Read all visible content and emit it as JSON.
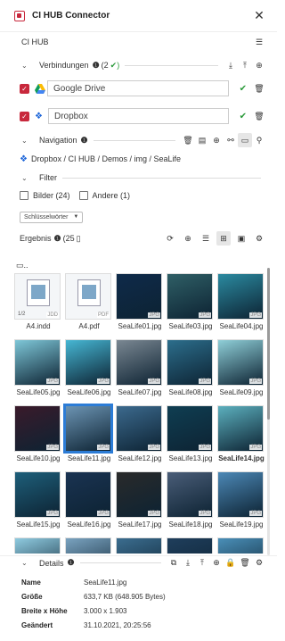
{
  "title": "CI HUB Connector",
  "close": "✕",
  "connector": {
    "label": "CI HUB"
  },
  "connections": {
    "label": "Verbindungen",
    "count": "(2",
    "items": [
      {
        "name": "Google Drive"
      },
      {
        "name": "Dropbox"
      }
    ]
  },
  "navigation": {
    "label": "Navigation"
  },
  "breadcrumb": "Dropbox / CI HUB / Demos / img / SeaLife",
  "filter": {
    "label": "Filter",
    "options": [
      {
        "label": "Bilder (24)"
      },
      {
        "label": "Andere (1)"
      }
    ],
    "keyword_select": "Schlüsselwörter"
  },
  "result": {
    "label": "Ergebnis",
    "count": "(25"
  },
  "folder_up": "..",
  "assets": [
    {
      "name": "A4.indd",
      "ext": "",
      "pager": "1/2",
      "pager_ext": "JDD",
      "kind": "doc",
      "color": "#4f7ca8"
    },
    {
      "name": "A4.pdf",
      "ext": "PDF",
      "kind": "doc",
      "color": "#4f7ca8"
    },
    {
      "name": "SeaLife01.jpg",
      "ext": "JPG",
      "color": "#0e2a4a"
    },
    {
      "name": "SeaLife03.jpg",
      "ext": "JPG",
      "color": "#2f5f66"
    },
    {
      "name": "SeaLife04.jpg",
      "ext": "JPG",
      "color": "#2b8aa0"
    },
    {
      "name": "SeaLife05.jpg",
      "ext": "JPG",
      "color": "#7ec7d8"
    },
    {
      "name": "SeaLife06.jpg",
      "ext": "JPG",
      "color": "#46b7d4"
    },
    {
      "name": "SeaLife07.jpg",
      "ext": "JPG",
      "color": "#7a8792"
    },
    {
      "name": "SeaLife08.jpg",
      "ext": "JPG",
      "color": "#2c6e8c"
    },
    {
      "name": "SeaLife09.jpg",
      "ext": "JPG",
      "color": "#8fcfd8"
    },
    {
      "name": "SeaLife10.jpg",
      "ext": "JPG",
      "color": "#3a1a2a"
    },
    {
      "name": "SeaLife11.jpg",
      "ext": "JPG",
      "color": "#6c94b3",
      "selected": true
    },
    {
      "name": "SeaLife12.jpg",
      "ext": "JPG",
      "color": "#3c6a8e"
    },
    {
      "name": "SeaLife13.jpg",
      "ext": "JPG",
      "color": "#0f3e52"
    },
    {
      "name": "SeaLife14.jpg",
      "ext": "JPG",
      "color": "#5cb0be",
      "bold": true
    },
    {
      "name": "SeaLife15.jpg",
      "ext": "JPG",
      "color": "#1e5f7a"
    },
    {
      "name": "SeaLife16.jpg",
      "ext": "JPG",
      "color": "#1a3352"
    },
    {
      "name": "SeaLife17.jpg",
      "ext": "JPG",
      "color": "#2a2a2a"
    },
    {
      "name": "SeaLife18.jpg",
      "ext": "JPG",
      "color": "#4a5d78"
    },
    {
      "name": "SeaLife19.jpg",
      "ext": "JPG",
      "color": "#4c88b6"
    },
    {
      "name": "",
      "ext": "",
      "color": "#8fcbe0"
    },
    {
      "name": "",
      "ext": "",
      "color": "#7aa3c0"
    },
    {
      "name": "",
      "ext": "",
      "color": "#3b6d8f"
    },
    {
      "name": "",
      "ext": "",
      "color": "#1f3e5c"
    },
    {
      "name": "",
      "ext": "",
      "color": "#4a8fb8"
    }
  ],
  "details": {
    "label": "Details",
    "rows": [
      {
        "key": "Name",
        "value": "SeaLife11.jpg"
      },
      {
        "key": "Größe",
        "value": "633,7 KB (648.905 Bytes)"
      },
      {
        "key": "Breite x Höhe",
        "value": "3.000 x 1.903"
      },
      {
        "key": "Geändert",
        "value": "31.10.2021, 20:25:56"
      }
    ]
  },
  "colors": {
    "accent_red": "#c8283c",
    "ok_green": "#2a9a3a",
    "selection_blue": "#2c7cd6"
  }
}
